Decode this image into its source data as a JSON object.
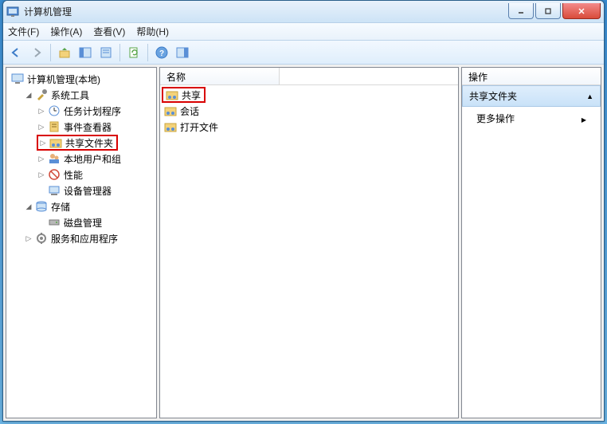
{
  "window": {
    "title": "计算机管理"
  },
  "menu": {
    "file": "文件(F)",
    "action": "操作(A)",
    "view": "查看(V)",
    "help": "帮助(H)"
  },
  "tree": {
    "root": "计算机管理(本地)",
    "system_tools": "系统工具",
    "task_scheduler": "任务计划程序",
    "event_viewer": "事件查看器",
    "shared_folders": "共享文件夹",
    "local_users": "本地用户和组",
    "performance": "性能",
    "device_manager": "设备管理器",
    "storage": "存储",
    "disk_management": "磁盘管理",
    "services_apps": "服务和应用程序"
  },
  "list": {
    "header_name": "名称",
    "items": {
      "shares": "共享",
      "sessions": "会话",
      "open_files": "打开文件"
    }
  },
  "actions": {
    "header": "操作",
    "section": "共享文件夹",
    "more": "更多操作"
  }
}
